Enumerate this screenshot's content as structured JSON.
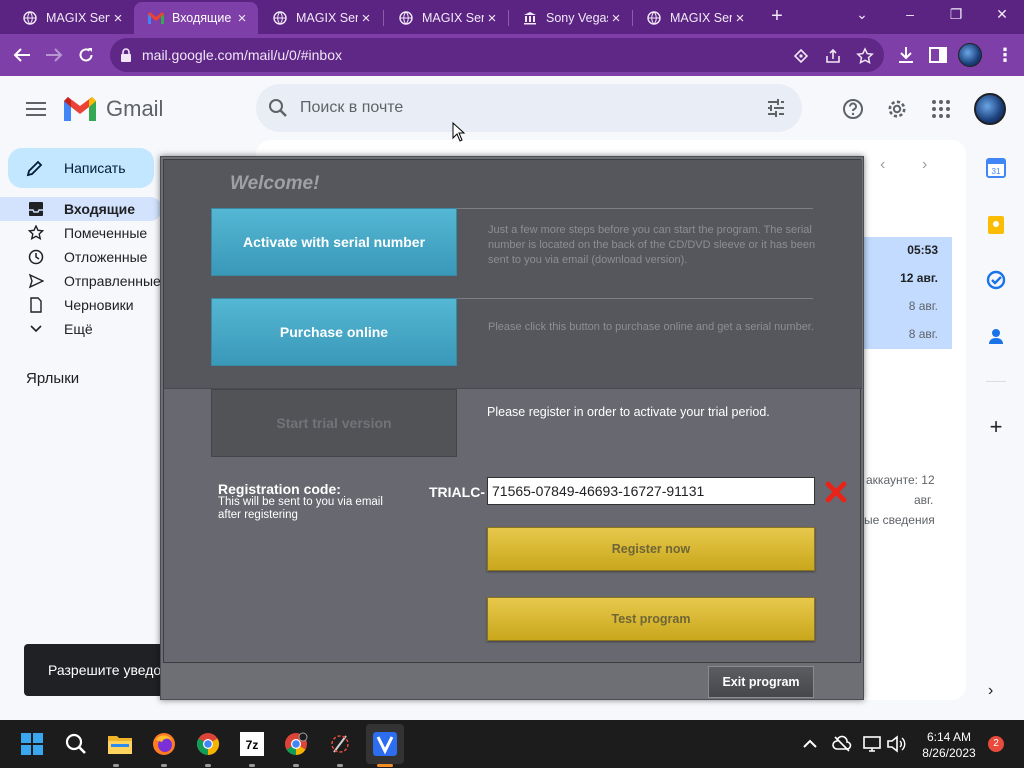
{
  "browser": {
    "tabs": [
      {
        "title": "MAGIX Serv",
        "favicon": "globe-icon"
      },
      {
        "title": "Входящие",
        "favicon": "gmail-icon"
      },
      {
        "title": "MAGIX Serv",
        "favicon": "globe-icon"
      },
      {
        "title": "MAGIX Serv",
        "favicon": "globe-icon"
      },
      {
        "title": "Sony Vegas",
        "favicon": "bank-icon"
      },
      {
        "title": "MAGIX Serv",
        "favicon": "globe-icon"
      }
    ],
    "url": "mail.google.com/mail/u/0/#inbox",
    "theme_color": "#7e3fa8"
  },
  "gmail": {
    "logo_text": "Gmail",
    "search_placeholder": "Поиск в почте",
    "compose_label": "Написать",
    "nav": [
      {
        "label": "Входящие",
        "icon": "inbox-icon"
      },
      {
        "label": "Помеченные",
        "icon": "star-icon"
      },
      {
        "label": "Отложенные",
        "icon": "clock-icon"
      },
      {
        "label": "Отправленные",
        "icon": "send-icon"
      },
      {
        "label": "Черновики",
        "icon": "draft-icon"
      },
      {
        "label": "Ещё",
        "icon": "chevron-down-icon"
      }
    ],
    "labels_heading": "Ярлыки",
    "mail_times": [
      "05:53",
      "12 авг.",
      "8 авг.",
      "8 авг."
    ],
    "storage_note": [
      "аккаунте: 12",
      "авг.",
      "ые сведения"
    ],
    "notification_toast": "Разрешите уведо"
  },
  "dialog": {
    "welcome": "Welcome!",
    "activate_label": "Activate with serial number",
    "activate_desc": "Just a few more steps before you can start the program. The serial number is located on the back of the CD/DVD sleeve or it has been sent to you via email (download version).",
    "purchase_label": "Purchase online",
    "purchase_desc": "Please click this button to purchase online and get a serial number.",
    "trial_label": "Start trial version",
    "register_msg": "Please register in order to activate your trial period.",
    "reg_code_title": "Registration code:",
    "reg_code_sub": "This will be sent to you via email after registering",
    "trial_prefix": "TRIALC-",
    "trial_code": "71565-07849-46693-16727-91131",
    "register_btn": "Register now",
    "test_btn": "Test program",
    "exit_btn": "Exit program",
    "accent_blue": "#3a98b8",
    "accent_gold": "#d4b22c"
  },
  "taskbar": {
    "time": "6:14 AM",
    "date": "8/26/2023",
    "notification_count": "2",
    "apps": [
      "windows-start-icon",
      "search-icon",
      "file-explorer-icon",
      "firefox-icon",
      "chrome-icon",
      "7zip-icon",
      "chrome-icon",
      "app-icon",
      "vegas-icon"
    ]
  }
}
